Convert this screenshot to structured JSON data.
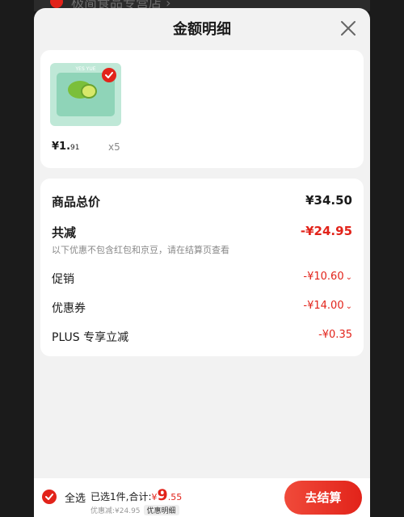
{
  "background": {
    "store_text": "极简食品专营店 ›"
  },
  "sheet": {
    "title": "金额明细"
  },
  "product": {
    "thumb_brand": "YES YUE",
    "price_int": "¥1.",
    "price_dec": "91",
    "qty": "x5"
  },
  "breakdown": {
    "total_label": "商品总价",
    "total_value": "¥34.50",
    "reduce_label": "共减",
    "reduce_value": "-¥24.95",
    "note": "以下优惠不包含红包和京豆，请在结算页查看",
    "items": [
      {
        "label": "促销",
        "value": "-¥10.60",
        "chevron": "⌄"
      },
      {
        "label": "优惠券",
        "value": "-¥14.00",
        "chevron": "⌄"
      },
      {
        "label": "PLUS 专享立减",
        "value": "-¥0.35",
        "chevron": ""
      }
    ]
  },
  "bottom": {
    "select_all": "全选",
    "selected_text": "已选1件,合计:",
    "total_yen": "¥",
    "total_int": "9",
    "total_dec": ".55",
    "discount_text": "优惠减:¥24.95",
    "discount_button": "优惠明细",
    "checkout": "去结算"
  },
  "colors": {
    "accent": "#e2231a",
    "sheet_bg": "#f2f2f2",
    "card_bg": "#ffffff"
  }
}
